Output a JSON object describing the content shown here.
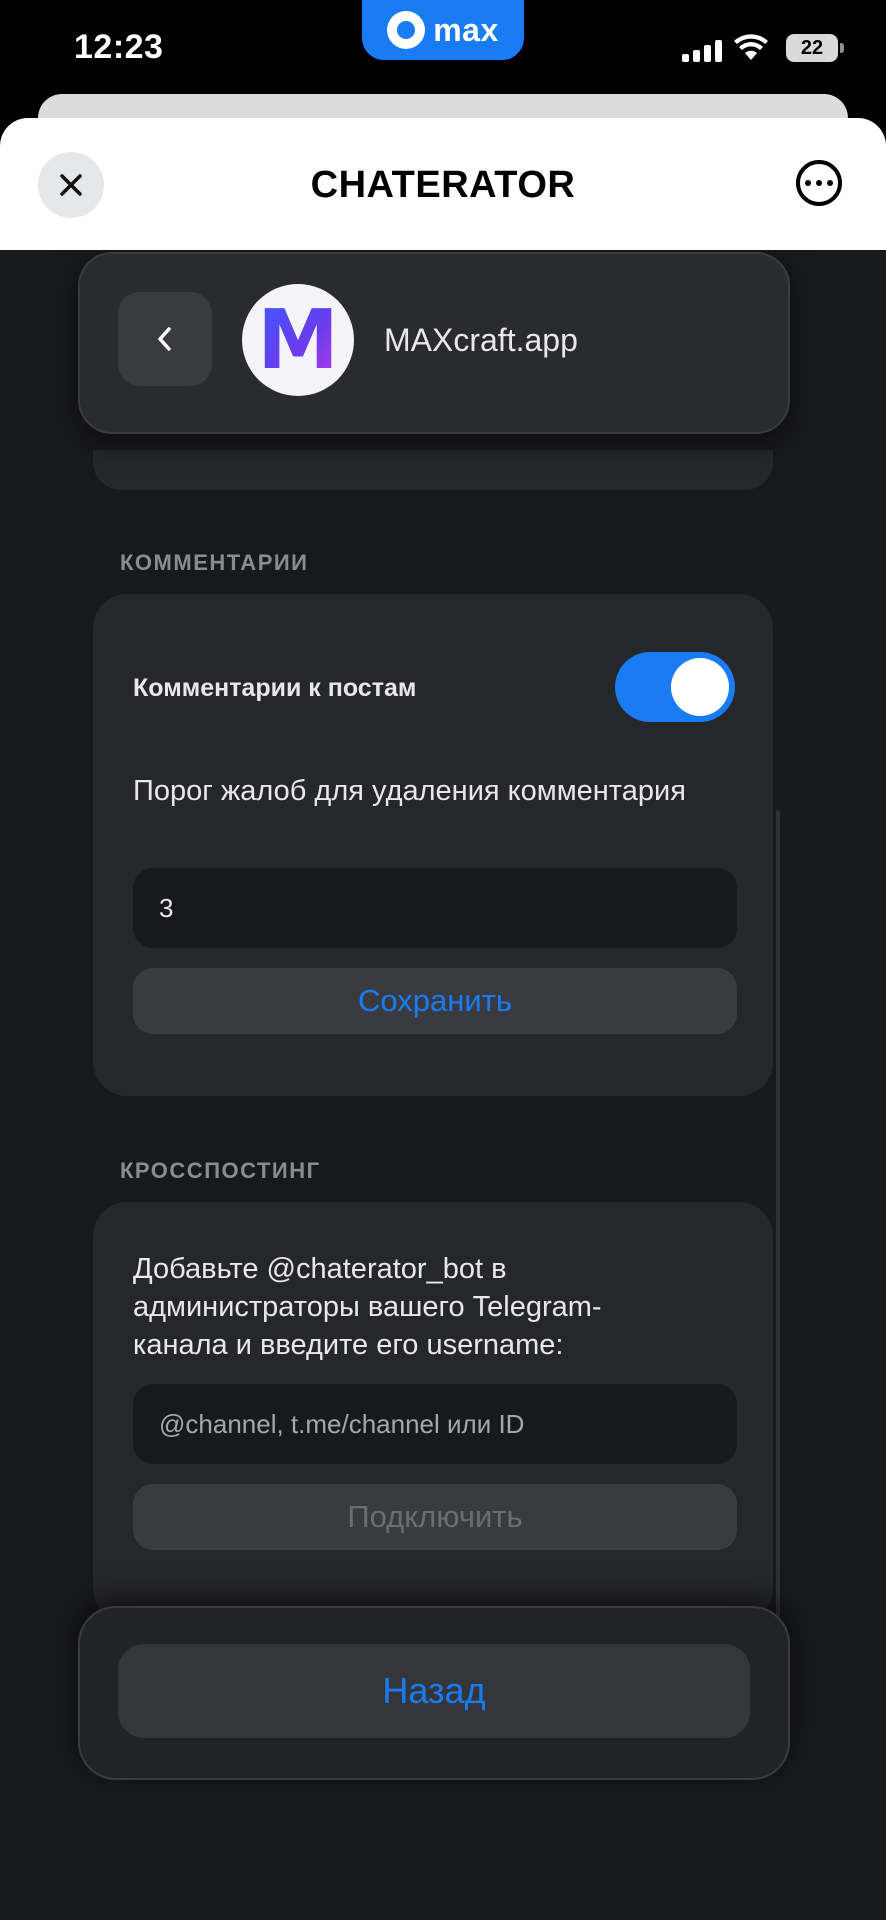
{
  "status_bar": {
    "time": "12:23",
    "app_badge": "max",
    "battery": "22"
  },
  "header": {
    "title": "CHATERATOR",
    "close_icon": "close-icon",
    "more_icon": "more-horizontal-circle-icon"
  },
  "app_card": {
    "logo_letter": "M",
    "name": "MAXcraft.app",
    "back_icon": "chevron-left-icon"
  },
  "comments": {
    "section_title": "КОММЕНТАРИИ",
    "toggle_label": "Комментарии к постам",
    "toggle_on": true,
    "threshold_label": "Порог жалоб для удаления комментария",
    "threshold_value": "3",
    "save_button": "Сохранить"
  },
  "crossposting": {
    "section_title": "КРОССПОСТИНГ",
    "description": "Добавьте @chaterator_bot в администраторы вашего Telegram-канала и введите его username:",
    "channel_placeholder": "@channel, t.me/channel или ID",
    "connect_button": "Подключить"
  },
  "footer": {
    "back_button": "Назад"
  },
  "colors": {
    "accent": "#1a7cf5",
    "background": "#18191d",
    "card": "#26272c"
  }
}
